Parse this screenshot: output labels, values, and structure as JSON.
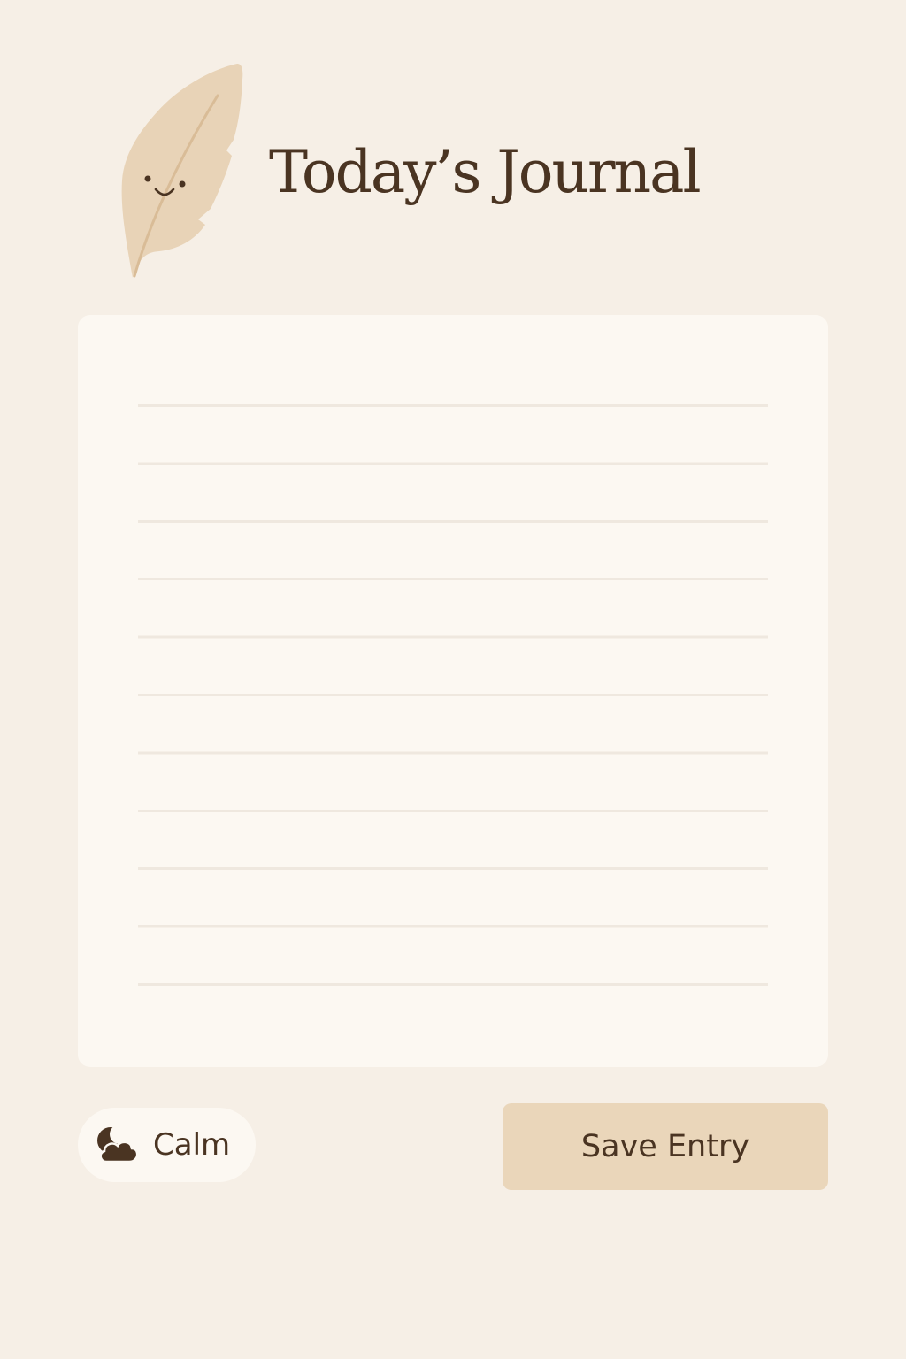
{
  "header": {
    "title": "Today’s Journal",
    "logo_icon": "smiling-feather-icon"
  },
  "entry": {
    "value": "",
    "placeholder": "",
    "ruled_line_count": 11
  },
  "mood": {
    "label": "Calm",
    "icon": "cloud-moon-icon"
  },
  "actions": {
    "save_label": "Save Entry"
  },
  "colors": {
    "background": "#f6efe6",
    "card": "#fcf8f2",
    "text": "#4a3422",
    "accent": "#ead6ba",
    "feather": "#e8d3b7",
    "rule_line": "#efe8df"
  }
}
